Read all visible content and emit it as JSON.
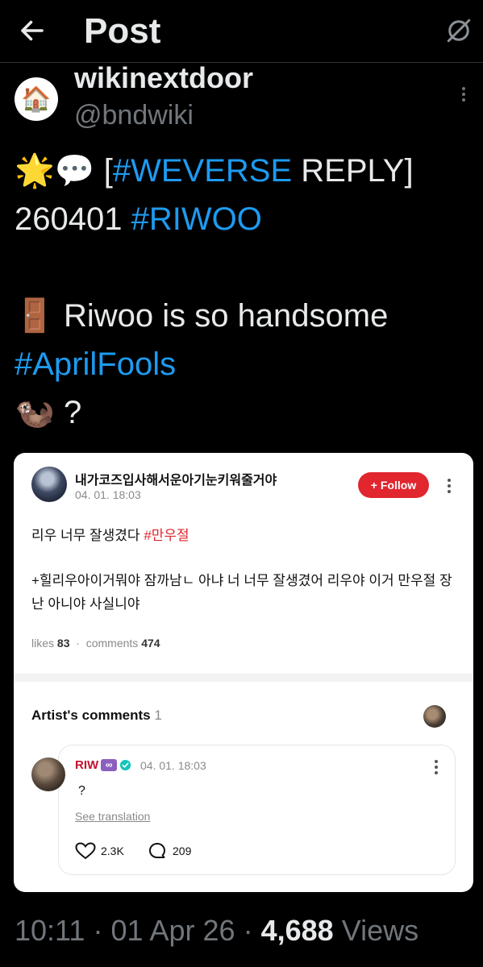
{
  "header": {
    "title": "Post"
  },
  "author": {
    "avatar_emoji": "🏠",
    "display_name": "wikinextdoor",
    "handle": "@bndwiki"
  },
  "tweet": {
    "line1_emoji": "🌟💬",
    "line1_open": "[",
    "line1_hashtag": "#WEVERSE",
    "line1_rest": "REPLY]",
    "line2_date": "260401",
    "line2_hashtag": "#RIWOO",
    "line3_emoji": "🚪",
    "line3_text": "Riwoo is so handsome",
    "line4_hashtag": "#AprilFools",
    "line5_emoji": "🦦",
    "line5_text": "?"
  },
  "weverse_card": {
    "poster_name": "내가코즈입사해서운아기눈키워줄거야",
    "poster_date": "04. 01. 18:03",
    "follow_label": "Follow",
    "post_text": "리우 너무 잘생겼다",
    "post_tag": "#만우절",
    "post_text2": "+힐리우아이거뭐야 잠까남ㄴ 아냐 너 너무 잘생겼어 리우야 이거 만우절 장난 아니야 사실니야",
    "likes_label": "likes",
    "likes_count": "83",
    "comments_label": "comments",
    "comments_count": "474",
    "artist_comments_label": "Artist's comments",
    "artist_comments_count": "1",
    "comment": {
      "artist_name": "RIW",
      "artist_badge": "∞",
      "date": "04. 01. 18:03",
      "text": "?",
      "see_translation": "See translation",
      "likes": "2.3K",
      "replies": "209"
    }
  },
  "footer": {
    "time": "10:11",
    "sep1": "·",
    "date": "01 Apr 26",
    "sep2": "·",
    "views_count": "4,688",
    "views_label": "Views"
  },
  "colors": {
    "background": "#000000",
    "link_blue": "#1d9bf0",
    "muted": "#71767b",
    "weverse_red": "#e1262e"
  }
}
